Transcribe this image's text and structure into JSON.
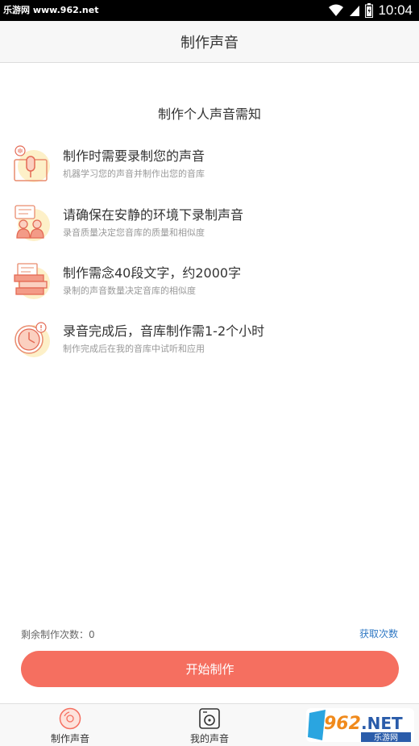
{
  "status_bar": {
    "site_text": "乐游网 www.962.net",
    "time": "10:04"
  },
  "header": {
    "title": "制作声音"
  },
  "section_title": "制作个人声音需知",
  "notices": [
    {
      "title": "制作时需要录制您的声音",
      "subtitle": "机器学习您的声音并制作出您的音库",
      "icon": "microphone-icon"
    },
    {
      "title": "请确保在安静的环境下录制声音",
      "subtitle": "录音质量决定您音库的质量和相似度",
      "icon": "quiet-environment-icon"
    },
    {
      "title": "制作需念40段文字，约2000字",
      "subtitle": "录制的声音数量决定音库的相似度",
      "icon": "text-documents-icon"
    },
    {
      "title": "录音完成后，音库制作需1-2个小时",
      "subtitle": "制作完成后在我的音库中试听和应用",
      "icon": "clock-icon"
    }
  ],
  "footer": {
    "remain_label": "剩余制作次数：0",
    "get_count_label": "获取次数",
    "start_button_label": "开始制作"
  },
  "tabs": [
    {
      "label": "制作声音",
      "icon": "record-disc-icon"
    },
    {
      "label": "我的声音",
      "icon": "my-voice-icon"
    }
  ],
  "watermark": {
    "text": "962.NET",
    "sub": "乐游网"
  },
  "colors": {
    "accent": "#f56f60",
    "link": "#2f78c4",
    "icon_bg": "#fdf0c8"
  }
}
